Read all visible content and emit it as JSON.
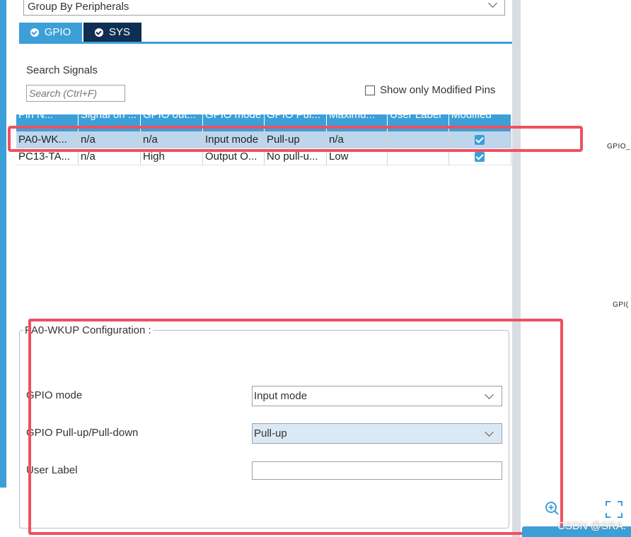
{
  "group_by": {
    "selected": "Group By Peripherals"
  },
  "tabs": [
    {
      "label": "GPIO",
      "active": true
    },
    {
      "label": "SYS",
      "active": false
    }
  ],
  "search": {
    "label": "Search Signals",
    "placeholder": "Search (Ctrl+F)"
  },
  "filter": {
    "show_modified_label": "Show only Modified Pins",
    "checked": false
  },
  "table": {
    "columns": [
      "Pin N...",
      "Signal on ...",
      "GPIO out...",
      "GPIO mode",
      "GPIO Pul...",
      "Maximu...",
      "User Label",
      "Modified"
    ],
    "rows": [
      {
        "pin": "PA0-WK...",
        "signal": "n/a",
        "gpio_out": "n/a",
        "gpio_mode": "Input mode",
        "gpio_pull": "Pull-up",
        "max": "n/a",
        "user_label": "",
        "modified": true,
        "selected": true
      },
      {
        "pin": "PC13-TA...",
        "signal": "n/a",
        "gpio_out": "High",
        "gpio_mode": "Output O...",
        "gpio_pull": "No pull-u...",
        "max": "Low",
        "user_label": "",
        "modified": true,
        "selected": false
      }
    ]
  },
  "config": {
    "title": "PA0-WKUP Configuration :",
    "gpio_mode_label": "GPIO mode",
    "gpio_mode_value": "Input mode",
    "pull_label": "GPIO Pull-up/Pull-down",
    "pull_value": "Pull-up",
    "user_label_label": "User Label",
    "user_label_value": ""
  },
  "right_panel": {
    "text_1": "GPIO_",
    "text_2": "GPI("
  },
  "watermark": "CSDN @SRA.",
  "colors": {
    "accent": "#3c9fd8",
    "tab_dark": "#0f2f52",
    "selected_row": "#bdd6ec",
    "highlight": "#f0505f"
  },
  "icons": [
    "chevron-down-icon",
    "check-circle-icon",
    "checkbox-checked-icon",
    "sort-up-icon",
    "zoom-in-icon",
    "fit-screen-icon"
  ]
}
